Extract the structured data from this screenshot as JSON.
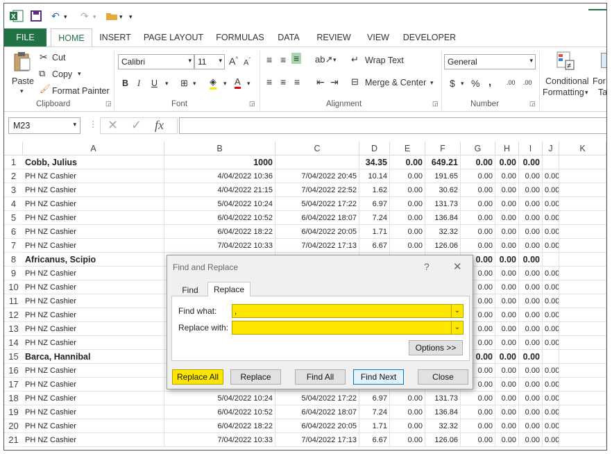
{
  "qat": {
    "undo": "↶",
    "redo": "↷"
  },
  "tabs": [
    "FILE",
    "HOME",
    "INSERT",
    "PAGE LAYOUT",
    "FORMULAS",
    "DATA",
    "REVIEW",
    "VIEW",
    "DEVELOPER"
  ],
  "ribbon": {
    "cut": "Cut",
    "copy": "Copy",
    "paste": "Paste",
    "format_painter": "Format Painter",
    "clipboard": "Clipboard",
    "font_name": "Calibri",
    "font_size": "11",
    "font": "Font",
    "bold": "B",
    "italic": "I",
    "underline": "U",
    "wrap_text": "Wrap Text",
    "merge_center": "Merge & Center",
    "alignment": "Alignment",
    "number_format": "General",
    "currency": "$",
    "percent": "%",
    "comma": ",",
    "number": "Number",
    "conditional": "Conditional",
    "formatting": "Formatting",
    "formatting_arrow": "▾",
    "format_as": "For",
    "format_as2": "Ta",
    "inc_dec": ".00",
    "dec_dec": ".00"
  },
  "formula_bar": {
    "name_box": "M23",
    "fx": "fx",
    "value": ""
  },
  "columns": [
    "A",
    "B",
    "C",
    "D",
    "E",
    "F",
    "G",
    "H",
    "I",
    "J",
    "K"
  ],
  "rows": [
    {
      "n": "1",
      "a": "Cobb, Julius",
      "b": "1000",
      "c": "",
      "d": "34.35",
      "e": "0.00",
      "f": "649.21",
      "g": "0.00",
      "h": "0.00",
      "i": "0.00",
      "j": "",
      "bold": true
    },
    {
      "n": "2",
      "a": "PH NZ Cashier",
      "b": "4/04/2022 10:36",
      "c": "7/04/2022 20:45",
      "d": "10.14",
      "e": "0.00",
      "f": "191.65",
      "g": "0.00",
      "h": "0.00",
      "i": "0.00",
      "j": "0.00"
    },
    {
      "n": "3",
      "a": "PH NZ Cashier",
      "b": "4/04/2022 21:15",
      "c": "7/04/2022 22:52",
      "d": "1.62",
      "e": "0.00",
      "f": "30.62",
      "g": "0.00",
      "h": "0.00",
      "i": "0.00",
      "j": "0.00"
    },
    {
      "n": "4",
      "a": "PH NZ Cashier",
      "b": "5/04/2022 10:24",
      "c": "5/04/2022 17:22",
      "d": "6.97",
      "e": "0.00",
      "f": "131.73",
      "g": "0.00",
      "h": "0.00",
      "i": "0.00",
      "j": "0.00"
    },
    {
      "n": "5",
      "a": "PH NZ Cashier",
      "b": "6/04/2022 10:52",
      "c": "6/04/2022 18:07",
      "d": "7.24",
      "e": "0.00",
      "f": "136.84",
      "g": "0.00",
      "h": "0.00",
      "i": "0.00",
      "j": "0.00"
    },
    {
      "n": "6",
      "a": "PH NZ Cashier",
      "b": "6/04/2022 18:22",
      "c": "6/04/2022 20:05",
      "d": "1.71",
      "e": "0.00",
      "f": "32.32",
      "g": "0.00",
      "h": "0.00",
      "i": "0.00",
      "j": "0.00"
    },
    {
      "n": "7",
      "a": "PH NZ Cashier",
      "b": "7/04/2022 10:33",
      "c": "7/04/2022 17:13",
      "d": "6.67",
      "e": "0.00",
      "f": "126.06",
      "g": "0.00",
      "h": "0.00",
      "i": "0.00",
      "j": "0.00"
    },
    {
      "n": "8",
      "a": "Africanus, Scipio",
      "b": "",
      "c": "",
      "d": "",
      "e": "",
      "f": "",
      "g": "0.00",
      "h": "0.00",
      "i": "0.00",
      "j": "",
      "bold": true
    },
    {
      "n": "9",
      "a": "PH NZ Cashier",
      "b": "",
      "c": "",
      "d": "",
      "e": "",
      "f": "",
      "g": "0.00",
      "h": "0.00",
      "i": "0.00",
      "j": "0.00"
    },
    {
      "n": "10",
      "a": "PH NZ Cashier",
      "b": "",
      "c": "",
      "d": "",
      "e": "",
      "f": "",
      "g": "0.00",
      "h": "0.00",
      "i": "0.00",
      "j": "0.00"
    },
    {
      "n": "11",
      "a": "PH NZ Cashier",
      "b": "",
      "c": "",
      "d": "",
      "e": "",
      "f": "",
      "g": "0.00",
      "h": "0.00",
      "i": "0.00",
      "j": "0.00"
    },
    {
      "n": "12",
      "a": "PH NZ Cashier",
      "b": "",
      "c": "",
      "d": "",
      "e": "",
      "f": "",
      "g": "0.00",
      "h": "0.00",
      "i": "0.00",
      "j": "0.00"
    },
    {
      "n": "13",
      "a": "PH NZ Cashier",
      "b": "",
      "c": "",
      "d": "",
      "e": "",
      "f": "",
      "g": "0.00",
      "h": "0.00",
      "i": "0.00",
      "j": "0.00"
    },
    {
      "n": "14",
      "a": "PH NZ Cashier",
      "b": "",
      "c": "",
      "d": "",
      "e": "",
      "f": "",
      "g": "0.00",
      "h": "0.00",
      "i": "0.00",
      "j": "0.00"
    },
    {
      "n": "15",
      "a": "Barca, Hannibal",
      "b": "",
      "c": "",
      "d": "",
      "e": "",
      "f": "",
      "g": "0.00",
      "h": "0.00",
      "i": "0.00",
      "j": "",
      "bold": true
    },
    {
      "n": "16",
      "a": "PH NZ Cashier",
      "b": "",
      "c": "",
      "d": "",
      "e": "",
      "f": "",
      "g": "0.00",
      "h": "0.00",
      "i": "0.00",
      "j": "0.00"
    },
    {
      "n": "17",
      "a": "PH NZ Cashier",
      "b": "",
      "c": "",
      "d": "",
      "e": "",
      "f": "",
      "g": "0.00",
      "h": "0.00",
      "i": "0.00",
      "j": "0.00"
    },
    {
      "n": "18",
      "a": "PH NZ Cashier",
      "b": "5/04/2022 10:24",
      "c": "5/04/2022 17:22",
      "d": "6.97",
      "e": "0.00",
      "f": "131.73",
      "g": "0.00",
      "h": "0.00",
      "i": "0.00",
      "j": "0.00"
    },
    {
      "n": "19",
      "a": "PH NZ Cashier",
      "b": "6/04/2022 10:52",
      "c": "6/04/2022 18:07",
      "d": "7.24",
      "e": "0.00",
      "f": "136.84",
      "g": "0.00",
      "h": "0.00",
      "i": "0.00",
      "j": "0.00"
    },
    {
      "n": "20",
      "a": "PH NZ Cashier",
      "b": "6/04/2022 18:22",
      "c": "6/04/2022 20:05",
      "d": "1.71",
      "e": "0.00",
      "f": "32.32",
      "g": "0.00",
      "h": "0.00",
      "i": "0.00",
      "j": "0.00"
    },
    {
      "n": "21",
      "a": "PH NZ Cashier",
      "b": "7/04/2022 10:33",
      "c": "7/04/2022 17:13",
      "d": "6.67",
      "e": "0.00",
      "f": "126.06",
      "g": "0.00",
      "h": "0.00",
      "i": "0.00",
      "j": "0.00"
    }
  ],
  "dialog": {
    "title": "Find and Replace",
    "help": "?",
    "close_x": "✕",
    "tab_find": "Find",
    "tab_replace": "Replace",
    "find_label": "Find what:",
    "find_value": ",",
    "replace_label": "Replace with:",
    "replace_value": "",
    "options": "Options >>",
    "replace_all": "Replace All",
    "replace": "Replace",
    "find_all": "Find All",
    "find_next": "Find Next",
    "close": "Close"
  },
  "colors": {
    "excel_green": "#217346",
    "highlight": "#ffe600",
    "focus_blue": "#0078d7"
  }
}
